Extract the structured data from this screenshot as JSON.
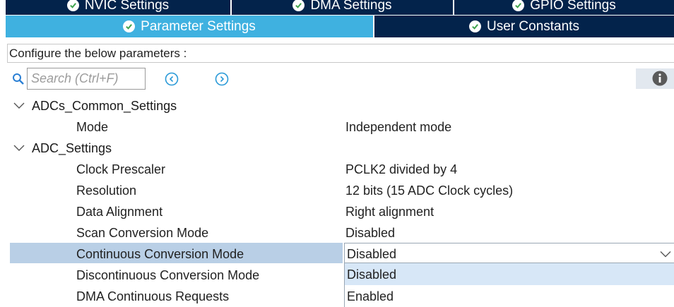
{
  "tabs_row1": [
    {
      "label": "NVIC Settings"
    },
    {
      "label": "DMA Settings"
    },
    {
      "label": "GPIO Settings"
    }
  ],
  "tabs_row2": [
    {
      "label": "Parameter Settings",
      "active": true
    },
    {
      "label": "User Constants",
      "active": false
    }
  ],
  "configure_text": "Configure the below parameters :",
  "search": {
    "placeholder": "Search (Ctrl+F)"
  },
  "tree": {
    "group1": {
      "label": "ADCs_Common_Settings"
    },
    "mode": {
      "label": "Mode",
      "value": "Independent mode"
    },
    "group2": {
      "label": "ADC_Settings"
    },
    "clock_prescaler": {
      "label": "Clock Prescaler",
      "value": "PCLK2 divided by 4"
    },
    "resolution": {
      "label": "Resolution",
      "value": "12 bits (15 ADC Clock cycles)"
    },
    "data_alignment": {
      "label": "Data Alignment",
      "value": "Right alignment"
    },
    "scan_conversion": {
      "label": "Scan Conversion Mode",
      "value": "Disabled"
    },
    "continuous_conversion": {
      "label": "Continuous Conversion Mode",
      "value": "Disabled"
    },
    "discontinuous_conversion": {
      "label": "Discontinuous Conversion Mode"
    },
    "dma_continuous": {
      "label": "DMA Continuous Requests"
    }
  },
  "dropdown_options": [
    "Disabled",
    "Enabled"
  ],
  "colors": {
    "tab_dark": "#03234b",
    "tab_active": "#3fb1e0",
    "selection": "#b9cfe6",
    "option_highlight": "#d7e7f7"
  }
}
